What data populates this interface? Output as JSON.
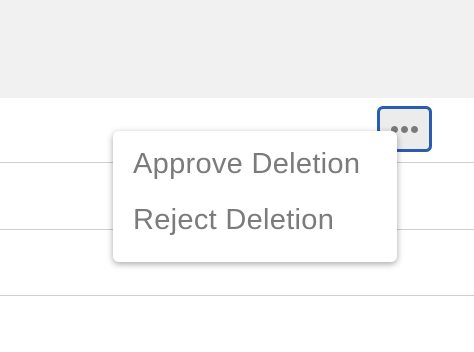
{
  "toolbar": {
    "more_button_icon": "ellipsis-icon"
  },
  "menu": {
    "items": [
      {
        "label": "Approve Deletion"
      },
      {
        "label": "Reject Deletion"
      }
    ]
  },
  "colors": {
    "focus_border": "#2a5db0",
    "menu_text": "#7b7b7b",
    "header_background": "#f1f1f1"
  }
}
